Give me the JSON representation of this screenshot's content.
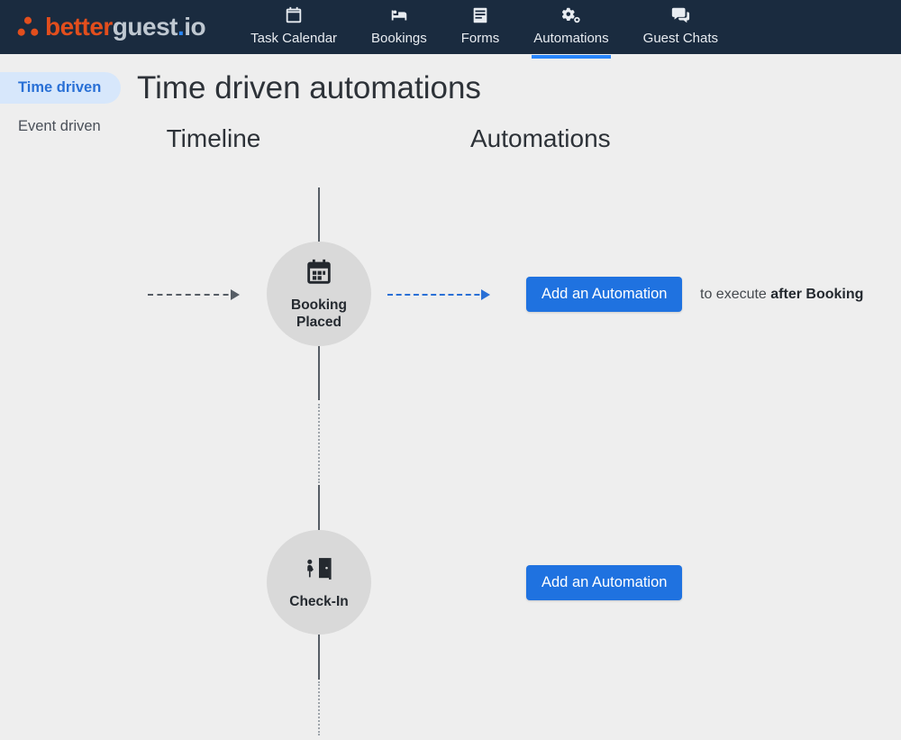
{
  "brand": {
    "part1": "better",
    "part2": "guest",
    "dot": ".",
    "part3": "io"
  },
  "nav": {
    "items": [
      {
        "label": "Task Calendar"
      },
      {
        "label": "Bookings"
      },
      {
        "label": "Forms"
      },
      {
        "label": "Automations"
      },
      {
        "label": "Guest Chats"
      }
    ]
  },
  "sidebar": {
    "items": [
      {
        "label": "Time driven"
      },
      {
        "label": "Event driven"
      }
    ]
  },
  "page": {
    "title": "Time driven automations",
    "timeline_header": "Timeline",
    "automations_header": "Automations"
  },
  "timeline": {
    "nodes": [
      {
        "label": "Booking\nPlaced"
      },
      {
        "label": "Check-In"
      }
    ]
  },
  "automations": {
    "rows": [
      {
        "add_label": "Add an Automation",
        "hint_prefix": "to execute ",
        "hint_strong": "after Booking"
      },
      {
        "add_label": "Add an Automation"
      }
    ]
  }
}
